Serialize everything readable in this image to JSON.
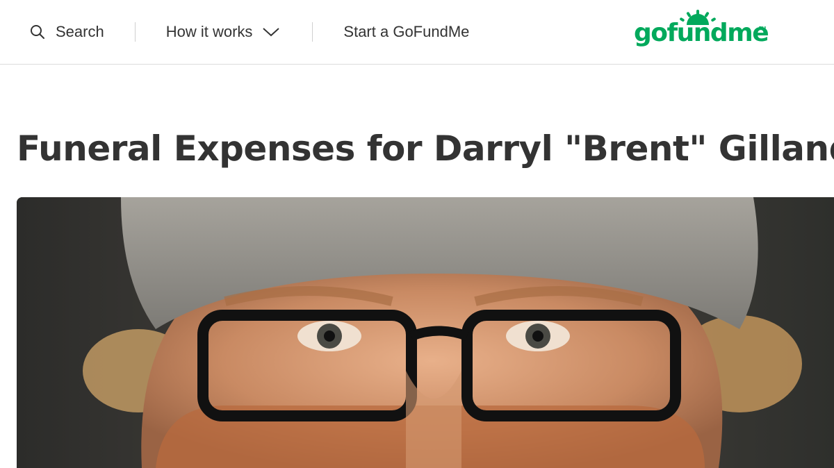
{
  "header": {
    "search_label": "Search",
    "how_it_works_label": "How it works",
    "start_label": "Start a GoFundMe",
    "logo_text": "gofundme",
    "logo_tm": "TM"
  },
  "campaign": {
    "title": "Funeral Expenses for Darryl \"Brent\" Gilland"
  },
  "icons": {
    "search": "search-icon",
    "dropdown": "chevron-down-icon"
  },
  "colors": {
    "brand_green": "#02a95c",
    "text": "#333333",
    "divider": "#dcdcdc"
  }
}
